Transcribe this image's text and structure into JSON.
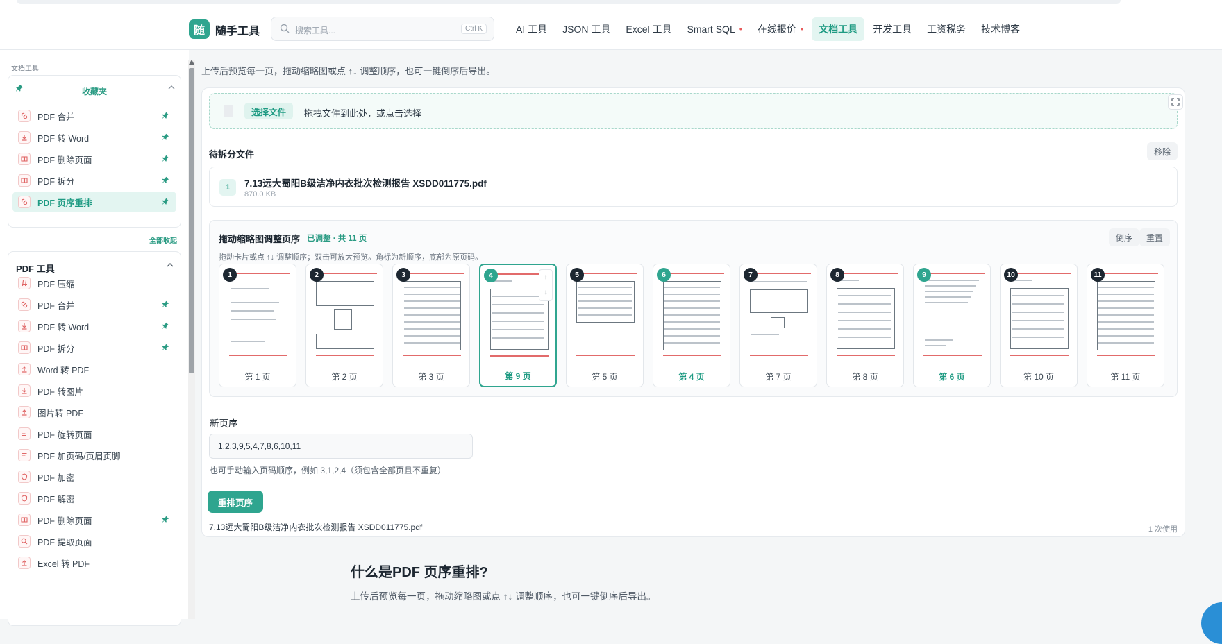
{
  "header": {
    "logo_char": "随",
    "brand": "随手工具",
    "search_placeholder": "搜索工具...",
    "search_kbd": "Ctrl K",
    "nav": [
      {
        "label": "AI 工具",
        "dot": ""
      },
      {
        "label": "JSON 工具",
        "dot": ""
      },
      {
        "label": "Excel 工具",
        "dot": ""
      },
      {
        "label": "Smart SQL",
        "dot": "•"
      },
      {
        "label": "在线报价",
        "dot": "•"
      },
      {
        "label": "文档工具",
        "dot": ""
      },
      {
        "label": "开发工具",
        "dot": ""
      },
      {
        "label": "工资税务",
        "dot": ""
      },
      {
        "label": "技术博客",
        "dot": ""
      }
    ],
    "active_nav": "文档工具"
  },
  "sidebar": {
    "section_label": "文档工具",
    "favorites_title": "收藏夹",
    "favorites": [
      {
        "label": "PDF 合并",
        "icon": "link-icon"
      },
      {
        "label": "PDF 转 Word",
        "icon": "download-icon"
      },
      {
        "label": "PDF 删除页面",
        "icon": "pages-icon"
      },
      {
        "label": "PDF 拆分",
        "icon": "pages-icon"
      },
      {
        "label": "PDF 页序重排",
        "icon": "link-icon"
      }
    ],
    "collapse_all": "全部收起",
    "tools_title": "PDF 工具",
    "tools": [
      {
        "label": "PDF 压缩",
        "icon": "hash-icon",
        "pinned": false
      },
      {
        "label": "PDF 合并",
        "icon": "link-icon",
        "pinned": true
      },
      {
        "label": "PDF 转 Word",
        "icon": "download-icon",
        "pinned": true
      },
      {
        "label": "PDF 拆分",
        "icon": "pages-icon",
        "pinned": true
      },
      {
        "label": "Word 转 PDF",
        "icon": "upload-icon",
        "pinned": false
      },
      {
        "label": "PDF 转图片",
        "icon": "download-icon",
        "pinned": false
      },
      {
        "label": "图片转 PDF",
        "icon": "upload-icon",
        "pinned": false
      },
      {
        "label": "PDF 旋转页面",
        "icon": "lines-icon",
        "pinned": false
      },
      {
        "label": "PDF 加页码/页眉页脚",
        "icon": "lines-icon",
        "pinned": false
      },
      {
        "label": "PDF 加密",
        "icon": "shield-icon",
        "pinned": false
      },
      {
        "label": "PDF 解密",
        "icon": "shield-icon",
        "pinned": false
      },
      {
        "label": "PDF 删除页面",
        "icon": "pages-icon",
        "pinned": true
      },
      {
        "label": "PDF 提取页面",
        "icon": "search-icon",
        "pinned": false
      },
      {
        "label": "Excel 转 PDF",
        "icon": "upload-icon",
        "pinned": false
      }
    ]
  },
  "main": {
    "intro": "上传后预览每一页，拖动缩略图或点 ↑↓ 调整顺序，也可一键倒序后导出。",
    "select_file": "选择文件",
    "drop_hint": "拖拽文件到此处，或点击选择",
    "pending_title": "待拆分文件",
    "remove_label": "移除",
    "file": {
      "index": "1",
      "name": "7.13远大蜀阳B级洁净内衣批次检测报告 XSDD011775.pdf",
      "size": "870.0 KB"
    },
    "reorder_title": "拖动缩略图调整页序",
    "reorder_badge": "已调整 · 共 11 页",
    "reverse_label": "倒序",
    "reset_label": "重置",
    "reorder_hint": "拖动卡片或点 ↑↓ 调整顺序；双击可放大预览。角标为新顺序，底部为原页码。",
    "thumbs": [
      {
        "badge": "1",
        "caption": "第 1 页",
        "moved": false,
        "kind": "cover"
      },
      {
        "badge": "2",
        "caption": "第 2 页",
        "moved": false,
        "kind": "photo"
      },
      {
        "badge": "3",
        "caption": "第 3 页",
        "moved": false,
        "kind": "table"
      },
      {
        "badge": "4",
        "caption": "第 9 页",
        "moved": true,
        "kind": "cert"
      },
      {
        "badge": "5",
        "caption": "第 5 页",
        "moved": false,
        "kind": "shorttable"
      },
      {
        "badge": "6",
        "caption": "第 4 页",
        "moved": true,
        "kind": "table"
      },
      {
        "badge": "7",
        "caption": "第 7 页",
        "moved": false,
        "kind": "stamp"
      },
      {
        "badge": "8",
        "caption": "第 8 页",
        "moved": false,
        "kind": "cert"
      },
      {
        "badge": "9",
        "caption": "第 6 页",
        "moved": true,
        "kind": "text"
      },
      {
        "badge": "10",
        "caption": "第 10 页",
        "moved": false,
        "kind": "cert"
      },
      {
        "badge": "11",
        "caption": "第 11 页",
        "moved": false,
        "kind": "table"
      }
    ],
    "active_thumb_index": 3,
    "thumb_up": "↑",
    "thumb_down": "↓",
    "order_label": "新页序",
    "order_value": "1,2,3,9,5,4,7,8,6,10,11",
    "order_help": "也可手动输入页码顺序，例如 3,1,2,4（须包含全部页且不重复）",
    "run_label": "重排页序",
    "result_name": "7.13远大蜀阳B级洁净内衣批次检测报告 XSDD011775.pdf",
    "usage": "1 次使用"
  },
  "about": {
    "title": "什么是PDF 页序重排?",
    "desc": "上传后预览每一页，拖动缩略图或点 ↑↓ 调整顺序，也可一键倒序后导出。"
  },
  "colors": {
    "accent": "#2fa58f",
    "dark_badge": "#1d2731",
    "pin": "#2a9b83"
  }
}
